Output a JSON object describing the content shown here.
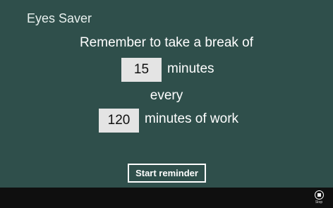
{
  "app": {
    "title": "Eyes Saver"
  },
  "form": {
    "prompt": "Remember to take a break of",
    "break_minutes": "15",
    "break_unit": "minutes",
    "every_label": "every",
    "work_minutes": "120",
    "work_unit": "minutes of work"
  },
  "actions": {
    "start_label": "Start reminder"
  },
  "app_bar": {
    "stop_label": "Stop"
  },
  "colors": {
    "background": "#2f4f4b",
    "input_bg": "#e4e4e4",
    "app_bar_bg": "#0f0f0f"
  }
}
